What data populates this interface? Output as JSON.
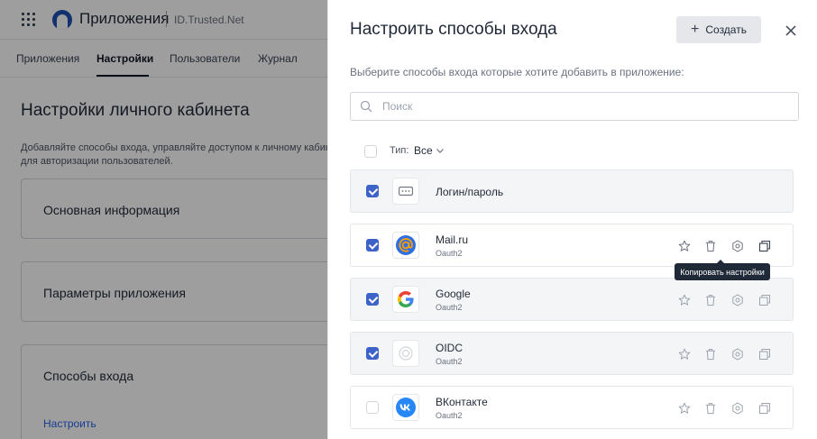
{
  "header": {
    "app_title": "Приложения",
    "brand": "ID.Trusted.Net"
  },
  "nav": {
    "tabs": [
      {
        "label": "Приложения"
      },
      {
        "label": "Настройки"
      },
      {
        "label": "Пользователи"
      },
      {
        "label": "Журнал"
      }
    ],
    "active_tab": "Настройки"
  },
  "page": {
    "heading": "Настройки личного кабинета",
    "description_line1": "Добавляйте способы входа, управляйте доступом к личному кабинету",
    "description_line2": "для авторизации пользователей.",
    "cards": [
      {
        "title": "Основная информация"
      },
      {
        "title": "Параметры приложения"
      },
      {
        "title": "Способы входа",
        "link": "Настроить"
      }
    ]
  },
  "panel": {
    "title": "Настроить способы входа",
    "create_label": "Создать",
    "subtitle": "Выберите способы входа которые хотите добавить в приложение:",
    "search": {
      "placeholder": "Поиск",
      "value": ""
    },
    "filter": {
      "label": "Тип:",
      "value": "Все"
    },
    "methods": [
      {
        "name": "Логин/пароль",
        "type": "",
        "checked": true,
        "icon": "password-icon"
      },
      {
        "name": "Mail.ru",
        "type": "Oauth2",
        "checked": true,
        "icon": "mailru-icon"
      },
      {
        "name": "Google",
        "type": "Oauth2",
        "checked": true,
        "icon": "google-icon"
      },
      {
        "name": "OIDC",
        "type": "Oauth2",
        "checked": true,
        "icon": "oidc-icon"
      },
      {
        "name": "ВКонтакте",
        "type": "Oauth2",
        "checked": false,
        "icon": "vk-icon"
      }
    ],
    "tooltip": "Копировать настройки"
  },
  "colors": {
    "accent": "#3d63c9",
    "mailru": "#2f6fe4",
    "vk": "#2787f5",
    "tooltip_bg": "#1f2937"
  }
}
